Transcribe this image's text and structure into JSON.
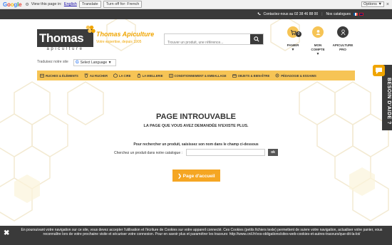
{
  "google_bar": {
    "logo_letters": [
      "G",
      "o",
      "o",
      "g",
      "l",
      "e"
    ],
    "logo_colors": [
      "#4285f4",
      "#ea4335",
      "#fbbc05",
      "#4285f4",
      "#34a853",
      "#ea4335"
    ],
    "view_text": "View this page in:",
    "language_link": "English",
    "translate_button": "Translate",
    "turn_off_button": "Turn off for: French",
    "options_label": "Options ▼",
    "close_glyph": "×"
  },
  "top_bar": {
    "contact": "Contactez-nous au 02 38 46 88 00",
    "separator": "|",
    "catalogues": "Nos catalogues"
  },
  "logo": {
    "main": "Thomas",
    "sub": "apiculture",
    "tagline": "Thomas Apiculture",
    "tagline_sub": "Votre expertise, depuis 1905"
  },
  "search": {
    "placeholder": "Trouver un produit, une référence..."
  },
  "header_icons": {
    "cart_label": "PANIER",
    "cart_count": "0",
    "account_label": "MON COMPTE",
    "pro_label_1": "APICULTURE",
    "pro_label_2": "PRO",
    "caret": "▼"
  },
  "translate": {
    "label": "Traduisez notre site",
    "select_value": "Select Language ▼"
  },
  "nav": {
    "items": [
      {
        "label": "RUCHES & ÉLÉMENTS"
      },
      {
        "label": "AU RUCHER"
      },
      {
        "label": "LA CIRE"
      },
      {
        "label": "LA MIELLERIE"
      },
      {
        "label": "CONDITIONNEMENT & EMBALLAGE"
      },
      {
        "label": "OBJETS & BIEN-ÊTRE"
      },
      {
        "label": "PÉDAGOGIE & ESSAIMS"
      }
    ]
  },
  "help": {
    "text": "BESOIN D'AIDE ?"
  },
  "main": {
    "title": "PAGE INTROUVABLE",
    "subtitle": "LA PAGE QUE VOUS AVEZ DEMANDÉE N'EXISTE PLUS.",
    "search_hint": "Pour rechercher un produit, saisissez son nom dans le champ ci-dessous",
    "search_label": "Cherchez un produit dans notre catalogue :",
    "ok_label": "ok",
    "home_button": "❯ Page d'accueil"
  },
  "cookie": {
    "close": "✖",
    "text": "En poursuivant votre navigation sur ce site, vous devez accepter l'utilisation et l'écriture de Cookies sur votre appareil connecté. Ces Cookies (petits fichiers texte) permettent de suivre votre navigation, actualiser votre panier, vous reconnaître lors de votre prochaine visite et sécuriser votre connexion. Pour en savoir plus et paramétrer les traceurs: http://www.cnil.fr/vos-obligations/sites-web-cookies-et-autres-traceurs/que-dit-la-loi/"
  },
  "colors": {
    "accent": "#f6c455",
    "orange": "#f5a623",
    "dark": "#3a3a3a"
  }
}
